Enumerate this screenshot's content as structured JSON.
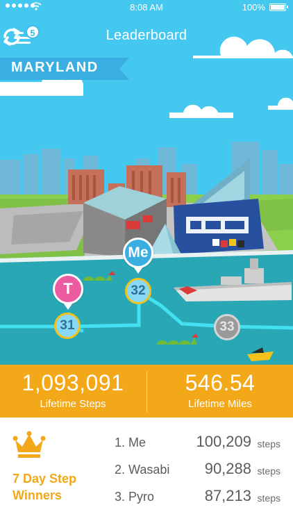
{
  "status_bar": {
    "time": "8:08 AM",
    "battery": "100%"
  },
  "header": {
    "title": "Leaderboard",
    "notification_count": "5",
    "menu_icon": "hamburger-menu-icon",
    "refresh_icon": "refresh-icon"
  },
  "map": {
    "state": "MARYLAND",
    "pins": [
      {
        "label": "Me"
      },
      {
        "label": "T"
      }
    ],
    "stops": [
      {
        "number": "31",
        "status": "reached"
      },
      {
        "number": "32",
        "status": "reached"
      },
      {
        "number": "33",
        "status": "locked"
      }
    ]
  },
  "stats": {
    "steps_value": "1,093,091",
    "steps_label": "Lifetime Steps",
    "miles_value": "546.54",
    "miles_label": "Lifetime Miles"
  },
  "winners": {
    "title_line1": "7 Day Step",
    "title_line2": "Winners",
    "crown_icon": "crown-icon",
    "unit": "steps",
    "entries": [
      {
        "rank_name": "1. Me",
        "steps": "100,209"
      },
      {
        "rank_name": "2. Wasabi",
        "steps": "90,288"
      },
      {
        "rank_name": "3. Pyro",
        "steps": "87,213"
      }
    ]
  },
  "colors": {
    "sky": "#45c8f0",
    "accent_orange": "#f3a81a",
    "pin_me": "#3aaee0",
    "pin_t": "#ec5aa0",
    "water": "#2aa7b5",
    "grass": "#8ccf4d"
  }
}
